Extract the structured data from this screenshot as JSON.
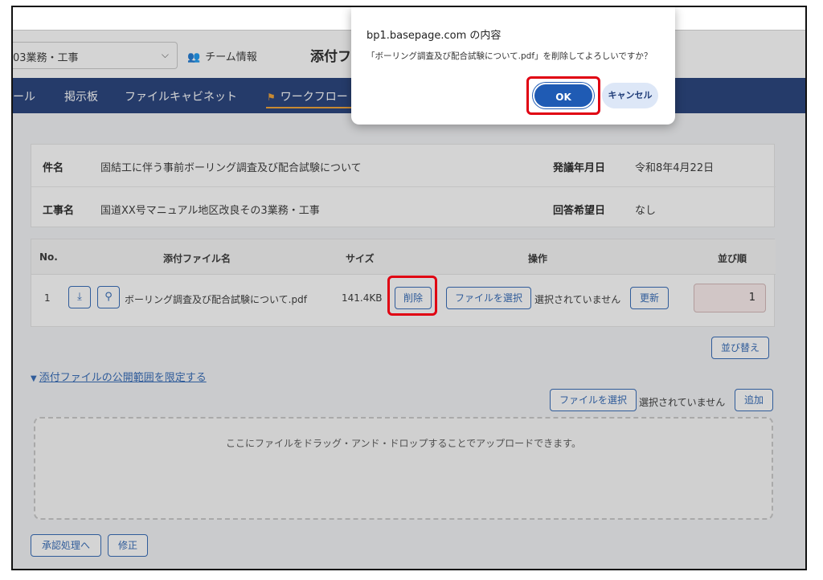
{
  "header": {
    "project_select_value": "03業務・工事",
    "team_info_label": "チーム情報",
    "page_title": "添付ファ"
  },
  "nav": {
    "items": [
      "ール",
      "掲示板",
      "ファイルキャビネット",
      "ワークフロー"
    ]
  },
  "info": {
    "subject_label": "件名",
    "subject_value": "固結工に伴う事前ボーリング調査及び配合試験について",
    "issue_date_label": "発議年月日",
    "issue_date_value": "令和8年4月22日",
    "project_label": "工事名",
    "project_value": "国道XX号マニュアル地区改良その3業務・工事",
    "reply_date_label": "回答希望日",
    "reply_date_value": "なし"
  },
  "file_table": {
    "headers": {
      "no": "No.",
      "name": "添付ファイル名",
      "size": "サイズ",
      "action": "操作",
      "order": "並び順"
    },
    "row": {
      "no": "1",
      "name": "ボーリング調査及び配合試験について.pdf",
      "size": "141.4KB",
      "delete_label": "削除",
      "choose_file_label": "ファイルを選択",
      "no_file_text": "選択されていません",
      "update_label": "更新",
      "order_value": "1"
    },
    "sort_label": "並び替え"
  },
  "limit_link": "添付ファイルの公開範囲を限定する",
  "upload": {
    "choose_file_label": "ファイルを選択",
    "no_file_text": "選択されていません",
    "add_label": "追加",
    "dropzone_text": "ここにファイルをドラッグ・アンド・ドロップすることでアップロードできます。"
  },
  "footer": {
    "approve_label": "承認処理へ",
    "edit_label": "修正"
  },
  "dialog": {
    "title": "bp1.basepage.com の内容",
    "message": "「ボーリング調査及び配合試験について.pdf」を削除してよろしいですか？",
    "ok_label": "OK",
    "cancel_label": "キャンセル"
  },
  "colors": {
    "nav_bg": "#1f3c78",
    "accent": "#2d66b5",
    "highlight": "#e00012"
  }
}
